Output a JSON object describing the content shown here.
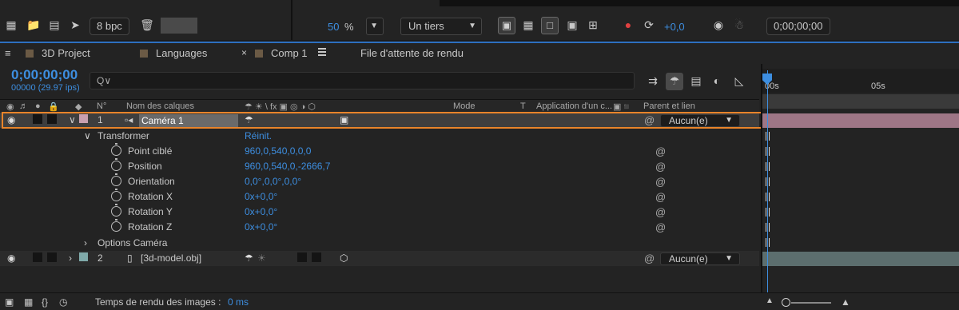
{
  "toolbar": {
    "bit_depth": "8 bpc",
    "zoom_value": "50",
    "zoom_unit": "%",
    "resolution": "Un tiers",
    "exposure": "+0,0",
    "timecode": "0;00;00;00"
  },
  "tabs": [
    {
      "label": "3D Project"
    },
    {
      "label": "Languages"
    },
    {
      "label": "Comp 1"
    },
    {
      "label": "File d'attente de rendu"
    }
  ],
  "comp": {
    "timecode": "0;00;00;00",
    "fps": "00000 (29.97 ips)",
    "search_placeholder": "Q∨"
  },
  "headers": {
    "num": "N°",
    "name": "Nom des calques",
    "switches": "☂ ☀ \\ fx ▣ ◎ ◑ ⬡",
    "mode": "Mode",
    "t": "T",
    "track": "Application d'un c...",
    "parent": "Parent et lien"
  },
  "layers": [
    {
      "num": "1",
      "name": "Caméra 1",
      "parent": "Aucun(e)",
      "color": "#c9a0b0"
    },
    {
      "num": "2",
      "name": "[3d-model.obj]",
      "parent": "Aucun(e)",
      "color": "#7fa9a9"
    }
  ],
  "transform": {
    "group_label": "Transformer",
    "reset_label": "Réinit.",
    "properties": [
      {
        "label": "Point ciblé",
        "value": "960,0,540,0,0,0"
      },
      {
        "label": "Position",
        "value": "960,0,540,0,-2666,7"
      },
      {
        "label": "Orientation",
        "value": "0,0°,0,0°,0,0°"
      },
      {
        "label": "Rotation X",
        "value": "0x+0,0°"
      },
      {
        "label": "Rotation Y",
        "value": "0x+0,0°"
      },
      {
        "label": "Rotation Z",
        "value": "0x+0,0°"
      }
    ],
    "camera_options_label": "Options Caméra"
  },
  "timeline": {
    "tick_start": "00s",
    "tick_5": "05s"
  },
  "footer": {
    "render_time_label": "Temps de rendu des images :",
    "render_time_value": "0 ms"
  },
  "colors": {
    "accent": "#3d8ee0",
    "highlight": "#e8842a"
  }
}
